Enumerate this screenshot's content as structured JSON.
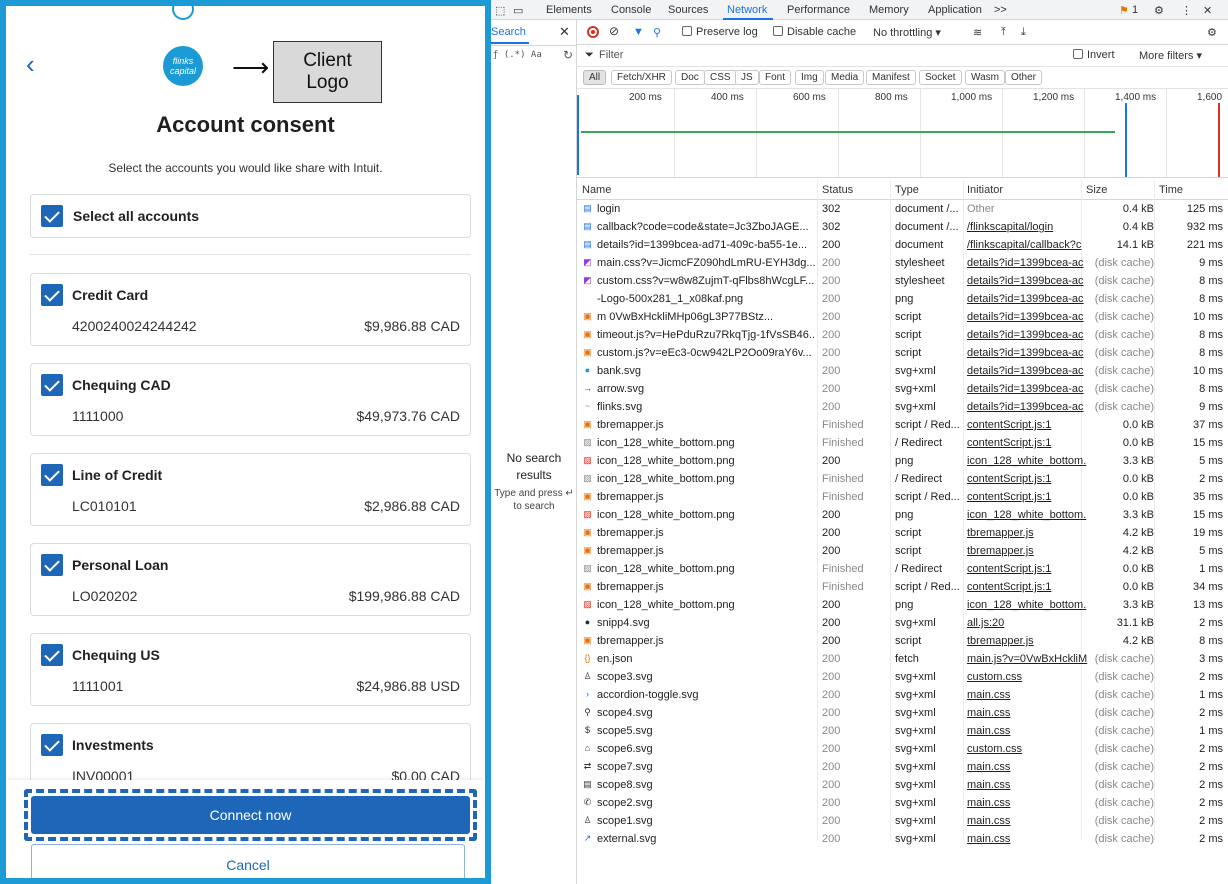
{
  "consent": {
    "client_logo_text": "Client\nLogo",
    "bank_logo_text": "flinks capital",
    "title": "Account consent",
    "subtitle": "Select the accounts you would like share with Intuit.",
    "select_all_label": "Select all accounts",
    "accounts": [
      {
        "name": "Credit Card",
        "number": "4200240024244242",
        "balance": "$9,986.88 CAD"
      },
      {
        "name": "Chequing CAD",
        "number": "1111000",
        "balance": "$49,973.76 CAD"
      },
      {
        "name": "Line of Credit",
        "number": "LC010101",
        "balance": "$2,986.88 CAD"
      },
      {
        "name": "Personal Loan",
        "number": "LO020202",
        "balance": "$199,986.88 CAD"
      },
      {
        "name": "Chequing US",
        "number": "1111001",
        "balance": "$24,986.88 USD"
      },
      {
        "name": "Investments",
        "number": "INV00001",
        "balance": "$0.00 CAD"
      }
    ],
    "connect_label": "Connect now",
    "cancel_label": "Cancel",
    "colors": {
      "accent": "#1e66b8",
      "frame": "#1b9ad6"
    }
  },
  "devtools": {
    "tabs": [
      "Elements",
      "Console",
      "Sources",
      "Network",
      "Performance",
      "Memory",
      "Application"
    ],
    "active_tab": "Network",
    "more_tabs": ">>",
    "issues_count": "1",
    "search": {
      "tab_label": "Search",
      "options": "ƒ (.*) Aa",
      "no_results_title": "No search results",
      "no_results_hint": "Type and press ↵ to search"
    },
    "toolbar": {
      "preserve_log": "Preserve log",
      "disable_cache": "Disable cache",
      "throttling": "No throttling",
      "filter_placeholder": "Filter",
      "invert": "Invert",
      "more_filters": "More filters"
    },
    "type_filters": [
      "All",
      "Fetch/XHR",
      "Doc",
      "CSS",
      "JS",
      "Font",
      "Img",
      "Media",
      "Manifest",
      "Socket",
      "Wasm",
      "Other"
    ],
    "timeline_ticks": [
      "200 ms",
      "400 ms",
      "600 ms",
      "800 ms",
      "1,000 ms",
      "1,200 ms",
      "1,400 ms",
      "1,600"
    ],
    "columns": [
      "Name",
      "Status",
      "Type",
      "Initiator",
      "Size",
      "Time"
    ],
    "requests": [
      {
        "icon": "doc",
        "name": "login",
        "status": "302",
        "type": "document /...",
        "initiator": "Other",
        "size": "0.4 kB",
        "time": "125 ms"
      },
      {
        "icon": "doc",
        "name": "callback?code=code&state=Jc3ZboJAGE...",
        "status": "302",
        "type": "document /...",
        "initiator": "/flinkscapital/login",
        "size": "0.4 kB",
        "time": "932 ms"
      },
      {
        "icon": "doc",
        "name": "details?id=1399bcea-ad71-409c-ba55-1e...",
        "status": "200",
        "type": "document",
        "initiator": "/flinkscapital/callback?c",
        "size": "14.1 kB",
        "time": "221 ms"
      },
      {
        "icon": "css",
        "name": "main.css?v=JicmcFZ090hdLmRU-EYH3dg...",
        "status": "200",
        "type": "stylesheet",
        "initiator": "details?id=1399bcea-ac",
        "size": "(disk cache)",
        "time": "9 ms"
      },
      {
        "icon": "css",
        "name": "custom.css?v=w8w8ZujmT-qFlbs8hWcgLF...",
        "status": "200",
        "type": "stylesheet",
        "initiator": "details?id=1399bcea-ac",
        "size": "(disk cache)",
        "time": "8 ms"
      },
      {
        "icon": "none",
        "name": "-Logo-500x281_1_x08kaf.png",
        "status": "200",
        "type": "png",
        "initiator": "details?id=1399bcea-ac",
        "size": "(disk cache)",
        "time": "8 ms"
      },
      {
        "icon": "js",
        "name": "m             0VwBxHckliMHp06gL3P77BStz...",
        "status": "200",
        "type": "script",
        "initiator": "details?id=1399bcea-ac",
        "size": "(disk cache)",
        "time": "10 ms"
      },
      {
        "icon": "js",
        "name": "timeout.js?v=HePduRzu7RkqTjg-1fVsSB46...",
        "status": "200",
        "type": "script",
        "initiator": "details?id=1399bcea-ac",
        "size": "(disk cache)",
        "time": "8 ms"
      },
      {
        "icon": "js",
        "name": "custom.js?v=eEc3-0cw942LP2Oo09raY6v...",
        "status": "200",
        "type": "script",
        "initiator": "details?id=1399bcea-ac",
        "size": "(disk cache)",
        "time": "8 ms"
      },
      {
        "icon": "bank",
        "name": "bank.svg",
        "status": "200",
        "type": "svg+xml",
        "initiator": "details?id=1399bcea-ac",
        "size": "(disk cache)",
        "time": "10 ms"
      },
      {
        "icon": "arrow",
        "name": "arrow.svg",
        "status": "200",
        "type": "svg+xml",
        "initiator": "details?id=1399bcea-ac",
        "size": "(disk cache)",
        "time": "8 ms"
      },
      {
        "icon": "flinks",
        "name": "flinks.svg",
        "status": "200",
        "type": "svg+xml",
        "initiator": "details?id=1399bcea-ac",
        "size": "(disk cache)",
        "time": "9 ms"
      },
      {
        "icon": "js",
        "name": "tbremapper.js",
        "status": "Finished",
        "type": "script / Red...",
        "initiator": "contentScript.js:1",
        "size": "0.0 kB",
        "time": "37 ms"
      },
      {
        "icon": "img",
        "name": "icon_128_white_bottom.png",
        "status": "Finished",
        "type": "/ Redirect",
        "initiator": "contentScript.js:1",
        "size": "0.0 kB",
        "time": "15 ms"
      },
      {
        "icon": "png",
        "name": "icon_128_white_bottom.png",
        "status": "200",
        "type": "png",
        "initiator": "icon_128_white_bottom.",
        "size": "3.3 kB",
        "time": "5 ms"
      },
      {
        "icon": "img",
        "name": "icon_128_white_bottom.png",
        "status": "Finished",
        "type": "/ Redirect",
        "initiator": "contentScript.js:1",
        "size": "0.0 kB",
        "time": "2 ms"
      },
      {
        "icon": "js",
        "name": "tbremapper.js",
        "status": "Finished",
        "type": "script / Red...",
        "initiator": "contentScript.js:1",
        "size": "0.0 kB",
        "time": "35 ms"
      },
      {
        "icon": "png",
        "name": "icon_128_white_bottom.png",
        "status": "200",
        "type": "png",
        "initiator": "icon_128_white_bottom.",
        "size": "3.3 kB",
        "time": "15 ms"
      },
      {
        "icon": "js",
        "name": "tbremapper.js",
        "status": "200",
        "type": "script",
        "initiator": "tbremapper.js",
        "size": "4.2 kB",
        "time": "19 ms"
      },
      {
        "icon": "js",
        "name": "tbremapper.js",
        "status": "200",
        "type": "script",
        "initiator": "tbremapper.js",
        "size": "4.2 kB",
        "time": "5 ms"
      },
      {
        "icon": "img",
        "name": "icon_128_white_bottom.png",
        "status": "Finished",
        "type": "/ Redirect",
        "initiator": "contentScript.js:1",
        "size": "0.0 kB",
        "time": "1 ms"
      },
      {
        "icon": "js",
        "name": "tbremapper.js",
        "status": "Finished",
        "type": "script / Red...",
        "initiator": "contentScript.js:1",
        "size": "0.0 kB",
        "time": "34 ms"
      },
      {
        "icon": "png",
        "name": "icon_128_white_bottom.png",
        "status": "200",
        "type": "png",
        "initiator": "icon_128_white_bottom.",
        "size": "3.3 kB",
        "time": "13 ms"
      },
      {
        "icon": "dot",
        "name": "snipp4.svg",
        "status": "200",
        "type": "svg+xml",
        "initiator": "all.js:20",
        "size": "31.1 kB",
        "time": "2 ms"
      },
      {
        "icon": "js",
        "name": "tbremapper.js",
        "status": "200",
        "type": "script",
        "initiator": "tbremapper.js",
        "size": "4.2 kB",
        "time": "8 ms"
      },
      {
        "icon": "json",
        "name": "en.json",
        "status": "200",
        "type": "fetch",
        "initiator": "main.js?v=0VwBxHckliM",
        "size": "(disk cache)",
        "time": "3 ms"
      },
      {
        "icon": "user",
        "name": "scope3.svg",
        "status": "200",
        "type": "svg+xml",
        "initiator": "custom.css",
        "size": "(disk cache)",
        "time": "2 ms"
      },
      {
        "icon": "chev",
        "name": "accordion-toggle.svg",
        "status": "200",
        "type": "svg+xml",
        "initiator": "main.css",
        "size": "(disk cache)",
        "time": "1 ms"
      },
      {
        "icon": "search",
        "name": "scope4.svg",
        "status": "200",
        "type": "svg+xml",
        "initiator": "main.css",
        "size": "(disk cache)",
        "time": "2 ms"
      },
      {
        "icon": "dollar",
        "name": "scope5.svg",
        "status": "200",
        "type": "svg+xml",
        "initiator": "main.css",
        "size": "(disk cache)",
        "time": "1 ms"
      },
      {
        "icon": "bank2",
        "name": "scope6.svg",
        "status": "200",
        "type": "svg+xml",
        "initiator": "custom.css",
        "size": "(disk cache)",
        "time": "2 ms"
      },
      {
        "icon": "swap",
        "name": "scope7.svg",
        "status": "200",
        "type": "svg+xml",
        "initiator": "main.css",
        "size": "(disk cache)",
        "time": "2 ms"
      },
      {
        "icon": "docs",
        "name": "scope8.svg",
        "status": "200",
        "type": "svg+xml",
        "initiator": "main.css",
        "size": "(disk cache)",
        "time": "2 ms"
      },
      {
        "icon": "phone",
        "name": "scope2.svg",
        "status": "200",
        "type": "svg+xml",
        "initiator": "main.css",
        "size": "(disk cache)",
        "time": "2 ms"
      },
      {
        "icon": "user",
        "name": "scope1.svg",
        "status": "200",
        "type": "svg+xml",
        "initiator": "main.css",
        "size": "(disk cache)",
        "time": "2 ms"
      },
      {
        "icon": "ext",
        "name": "external.svg",
        "status": "200",
        "type": "svg+xml",
        "initiator": "main.css",
        "size": "(disk cache)",
        "time": "2 ms"
      }
    ]
  }
}
